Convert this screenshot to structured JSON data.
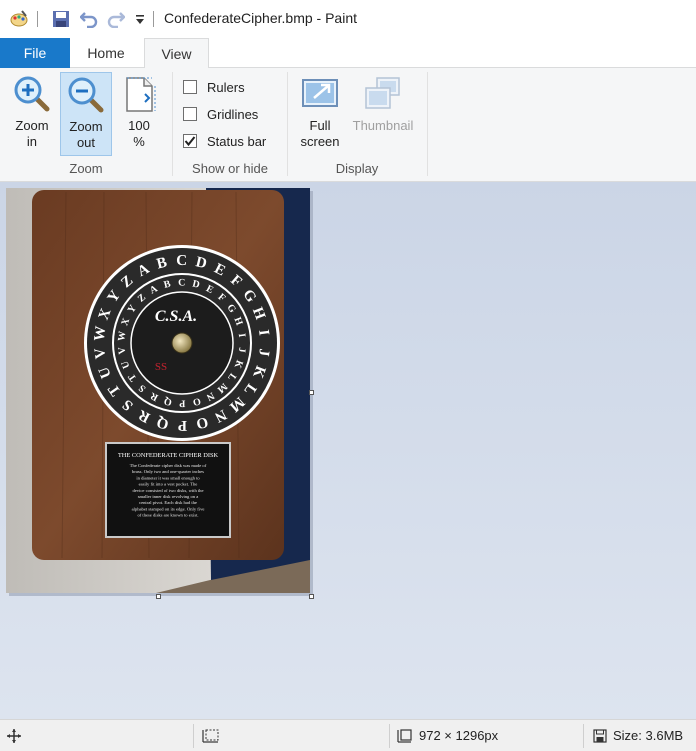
{
  "window": {
    "title": "ConfederateCipher.bmp - Paint"
  },
  "quick_access": {
    "app_icon": "paint-palette-icon",
    "save_icon": "save-icon",
    "undo_icon": "undo-icon",
    "redo_icon": "redo-icon",
    "customize_icon": "customize-dropdown-icon"
  },
  "tabs": [
    {
      "label": "File"
    },
    {
      "label": "Home"
    },
    {
      "label": "View"
    }
  ],
  "ribbon": {
    "zoom_group": {
      "label": "Zoom",
      "zoom_in_line1": "Zoom",
      "zoom_in_line2": "in",
      "zoom_out_line1": "Zoom",
      "zoom_out_line2": "out",
      "hundred_line1": "100",
      "hundred_line2": "%"
    },
    "show_hide_group": {
      "label": "Show or hide",
      "rulers": {
        "label": "Rulers",
        "checked": false
      },
      "gridlines": {
        "label": "Gridlines",
        "checked": false
      },
      "status_bar": {
        "label": "Status bar",
        "checked": true
      }
    },
    "display_group": {
      "label": "Display",
      "full_screen_line1": "Full",
      "full_screen_line2": "screen",
      "thumbnail": "Thumbnail"
    }
  },
  "image": {
    "disk_outer_letters": "ABCDEFGHIJKLMNOPQRSTUVWXYZ",
    "disk_inner_letters": "ABCDEFGHIJKLMNOPQRSTUVWXYZ",
    "center_label": "C.S.A.",
    "center_mark": "SS",
    "plaque_title": "THE CONFEDERATE CIPHER DISK",
    "plaque_body": "The Confederate cipher disk was made of brass. Only two and one-quarter inches in diameter it was small enough to easily fit into a vest pocket. The device consisted of two disks, with the smaller inner disk revolving on a central pivot. Each disk had the alphabet stamped on its edge. Only five of these disks are known to exist."
  },
  "status_bar": {
    "cursor_icon": "move-cursor-icon",
    "selection_icon": "selection-size-icon",
    "dimensions_icon": "image-dimensions-icon",
    "dimensions": "972 × 1296px",
    "size_icon": "disk-size-icon",
    "size": "Size: 3.6MB"
  },
  "colors": {
    "file_tab": "#1979ca",
    "ribbon_bg": "#f5f6f7",
    "canvas_bg": "#cbd5e6",
    "active_button": "#cde4f7"
  }
}
